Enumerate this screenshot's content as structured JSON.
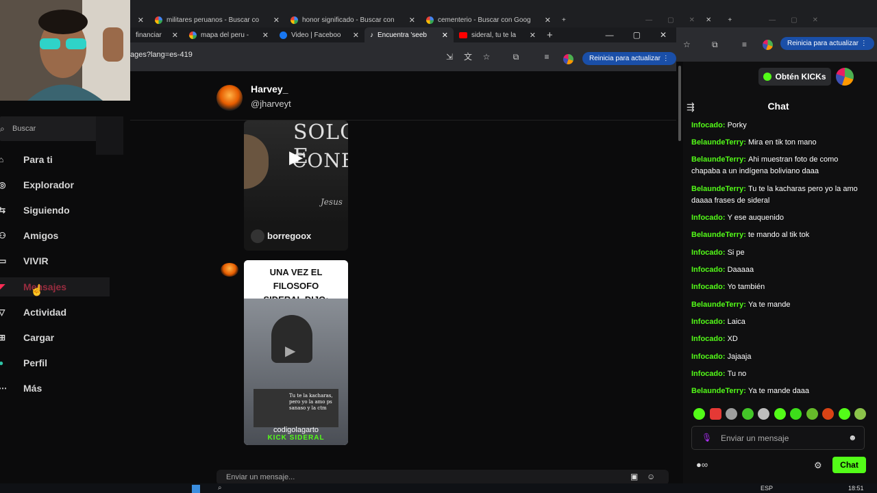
{
  "background_browser": {
    "tabs": [
      "militares peruanos - Buscar co",
      "honor significado - Buscar con",
      "cementerio - Buscar con Goog"
    ]
  },
  "browser": {
    "tabs": [
      {
        "label": "financiar"
      },
      {
        "label": "mapa del peru -"
      },
      {
        "label": "Video | Faceboo"
      },
      {
        "label": "Encuentra 'seeb"
      },
      {
        "label": "sideral, tu te la"
      }
    ],
    "url": "ages?lang=es-419",
    "update_button": "Reinicia para actualizar",
    "update_button_right": "Reinicia para actualizar"
  },
  "sidebar": {
    "search_label": "Buscar",
    "items": [
      {
        "label": "Para ti",
        "icon": "home-icon"
      },
      {
        "label": "Explorador",
        "icon": "compass-icon"
      },
      {
        "label": "Siguiendo",
        "icon": "following-icon"
      },
      {
        "label": "Amigos",
        "icon": "friends-icon"
      },
      {
        "label": "VIVIR",
        "icon": "live-icon"
      },
      {
        "label": "Mensajes",
        "icon": "messages-icon"
      },
      {
        "label": "Actividad",
        "icon": "activity-icon"
      },
      {
        "label": "Cargar",
        "icon": "upload-icon"
      },
      {
        "label": "Perfil",
        "icon": "profile-icon"
      },
      {
        "label": "Más",
        "icon": "more-icon"
      }
    ]
  },
  "conversation": {
    "name": "Harvey_",
    "handle": "@jharveyt",
    "video1": {
      "overlay_top": "SOLO E",
      "overlay_mid": "CONFU",
      "signature": "Jesus",
      "username": "borregoox"
    },
    "video2": {
      "caption": "UNA VEZ EL FILOSOFO SIDERAL DIJO:",
      "inset_text": "Tu te la kacharas, pero yo la amo ps sanaso y la ctm",
      "watermark": "codigolagarto",
      "badge": "KICK SIDERAL"
    },
    "message_placeholder": "Enviar un mensaje..."
  },
  "kick": {
    "get_kicks": "Obtén KICKs",
    "chat_title": "Chat",
    "messages": [
      {
        "user": "Infocado",
        "text": "Porky"
      },
      {
        "user": "BelaundeTerry",
        "text": "Mira en tik ton mano"
      },
      {
        "user": "BelaundeTerry",
        "text": "Ahi muestran foto de como chapaba a un indígena boliviano daaa"
      },
      {
        "user": "BelaundeTerry",
        "text": "Tu te la kacharas pero yo la amo daaaa frases de sideral"
      },
      {
        "user": "Infocado",
        "text": "Y ese auquenido"
      },
      {
        "user": "BelaundeTerry",
        "text": "te mando al tik tok"
      },
      {
        "user": "Infocado",
        "text": "Si pe"
      },
      {
        "user": "Infocado",
        "text": "Daaaaa"
      },
      {
        "user": "Infocado",
        "text": "Yo también"
      },
      {
        "user": "BelaundeTerry",
        "text": "Ya te mande"
      },
      {
        "user": "Infocado",
        "text": "Laica"
      },
      {
        "user": "Infocado",
        "text": "XD"
      },
      {
        "user": "Infocado",
        "text": "Jajaaja"
      },
      {
        "user": "Infocado",
        "text": "Tu no"
      },
      {
        "user": "BelaundeTerry",
        "text": "Ya te mande daaa"
      }
    ],
    "input_placeholder": "Enviar un mensaje",
    "chat_button": "Chat",
    "accent": "#53fc18"
  },
  "taskbar": {
    "lang": "ESP",
    "time": "18:51"
  }
}
